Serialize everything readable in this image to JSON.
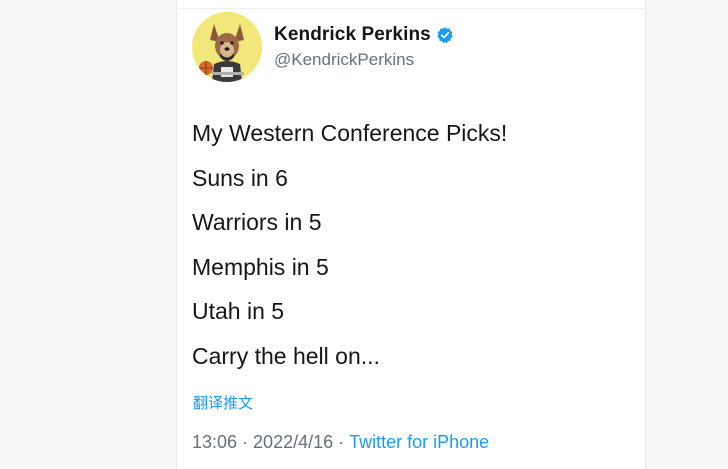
{
  "author": {
    "display_name": "Kendrick Perkins",
    "handle": "@KendrickPerkins",
    "verified": true,
    "avatar_icon": "cartoon-dog-avatar-icon",
    "verified_icon": "verified-badge-icon",
    "verified_color": "#1d9bf0"
  },
  "tweet": {
    "lines": [
      "My Western Conference Picks!",
      "Suns in 6",
      "Warriors in 5",
      "Memphis in 5",
      "Utah in 5",
      "Carry the hell on..."
    ],
    "translate_label": "翻译推文"
  },
  "meta": {
    "time": "13:06",
    "separator": "·",
    "date": "2022/4/16",
    "source": "Twitter for iPhone"
  },
  "colors": {
    "accent": "#1d9bf0",
    "text": "#14171a",
    "secondary_text": "#65717c",
    "avatar_bg": "#f1e77a"
  }
}
